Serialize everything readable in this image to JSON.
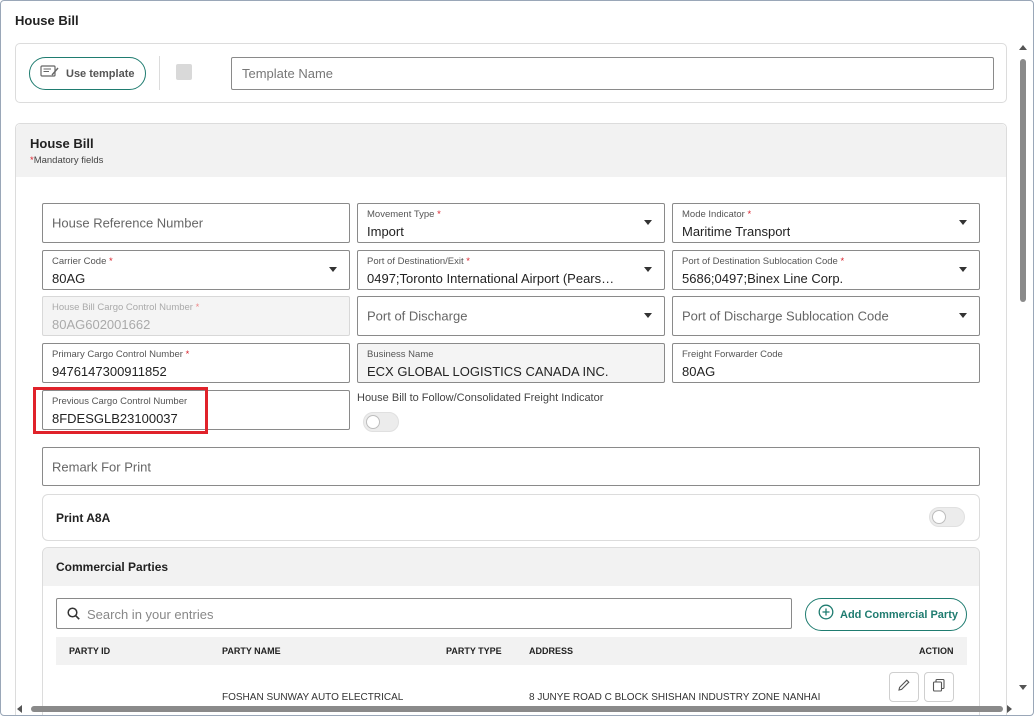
{
  "window": {
    "title": "House Bill"
  },
  "template": {
    "use_template_label": "Use template",
    "template_name_placeholder": "Template Name"
  },
  "house_bill": {
    "title": "House Bill",
    "mandatory_note": "Mandatory fields",
    "fields": {
      "house_reference_number": {
        "placeholder": "House Reference Number"
      },
      "movement_type": {
        "label": "Movement Type",
        "value": "Import"
      },
      "mode_indicator": {
        "label": "Mode Indicator",
        "value": "Maritime Transport"
      },
      "carrier_code": {
        "label": "Carrier Code",
        "value": "80AG"
      },
      "port_of_destination": {
        "label": "Port of Destination/Exit",
        "value": "0497;Toronto International Airport (Pears…"
      },
      "port_of_destination_sublocation": {
        "label": "Port of Destination Sublocation Code",
        "value": "5686;0497;Binex Line Corp."
      },
      "house_bill_ccn": {
        "label": "House Bill Cargo Control Number",
        "value": "80AG602001662"
      },
      "port_of_discharge": {
        "placeholder": "Port of Discharge"
      },
      "port_of_discharge_sublocation": {
        "placeholder": "Port of Discharge Sublocation Code"
      },
      "primary_ccn": {
        "label": "Primary Cargo Control Number",
        "value": "9476147300911852"
      },
      "business_name": {
        "label": "Business Name",
        "value": "ECX GLOBAL LOGISTICS CANADA INC."
      },
      "freight_forwarder_code": {
        "label": "Freight Forwarder Code",
        "value": "80AG"
      },
      "previous_ccn": {
        "label": "Previous Cargo Control Number",
        "value": "8FDESGLB23100037"
      },
      "remark_for_print": {
        "placeholder": "Remark For Print"
      }
    },
    "follow_indicator_label": "House Bill to Follow/Consolidated Freight Indicator",
    "follow_indicator_on": false
  },
  "print_a8a": {
    "title": "Print A8A",
    "on": false
  },
  "commercial_parties": {
    "title": "Commercial Parties",
    "search_placeholder": "Search in your entries",
    "add_label": "Add Commercial Party",
    "columns": [
      "PARTY ID",
      "PARTY NAME",
      "PARTY TYPE",
      "ADDRESS",
      "ACTION"
    ],
    "rows": [
      {
        "party_id": "",
        "party_name": "FOSHAN SUNWAY AUTO ELECTRICAL",
        "party_type": "",
        "address": "8 JUNYE ROAD C BLOCK SHISHAN INDUSTRY ZONE NANHAI"
      }
    ]
  },
  "colors": {
    "accent": "#1f7c70",
    "mandatory": "#d9232d",
    "highlight": "#e0222a"
  },
  "icons": [
    "note-edit-icon",
    "search-icon",
    "plus-circle-icon",
    "pencil-icon",
    "copy-icon"
  ]
}
